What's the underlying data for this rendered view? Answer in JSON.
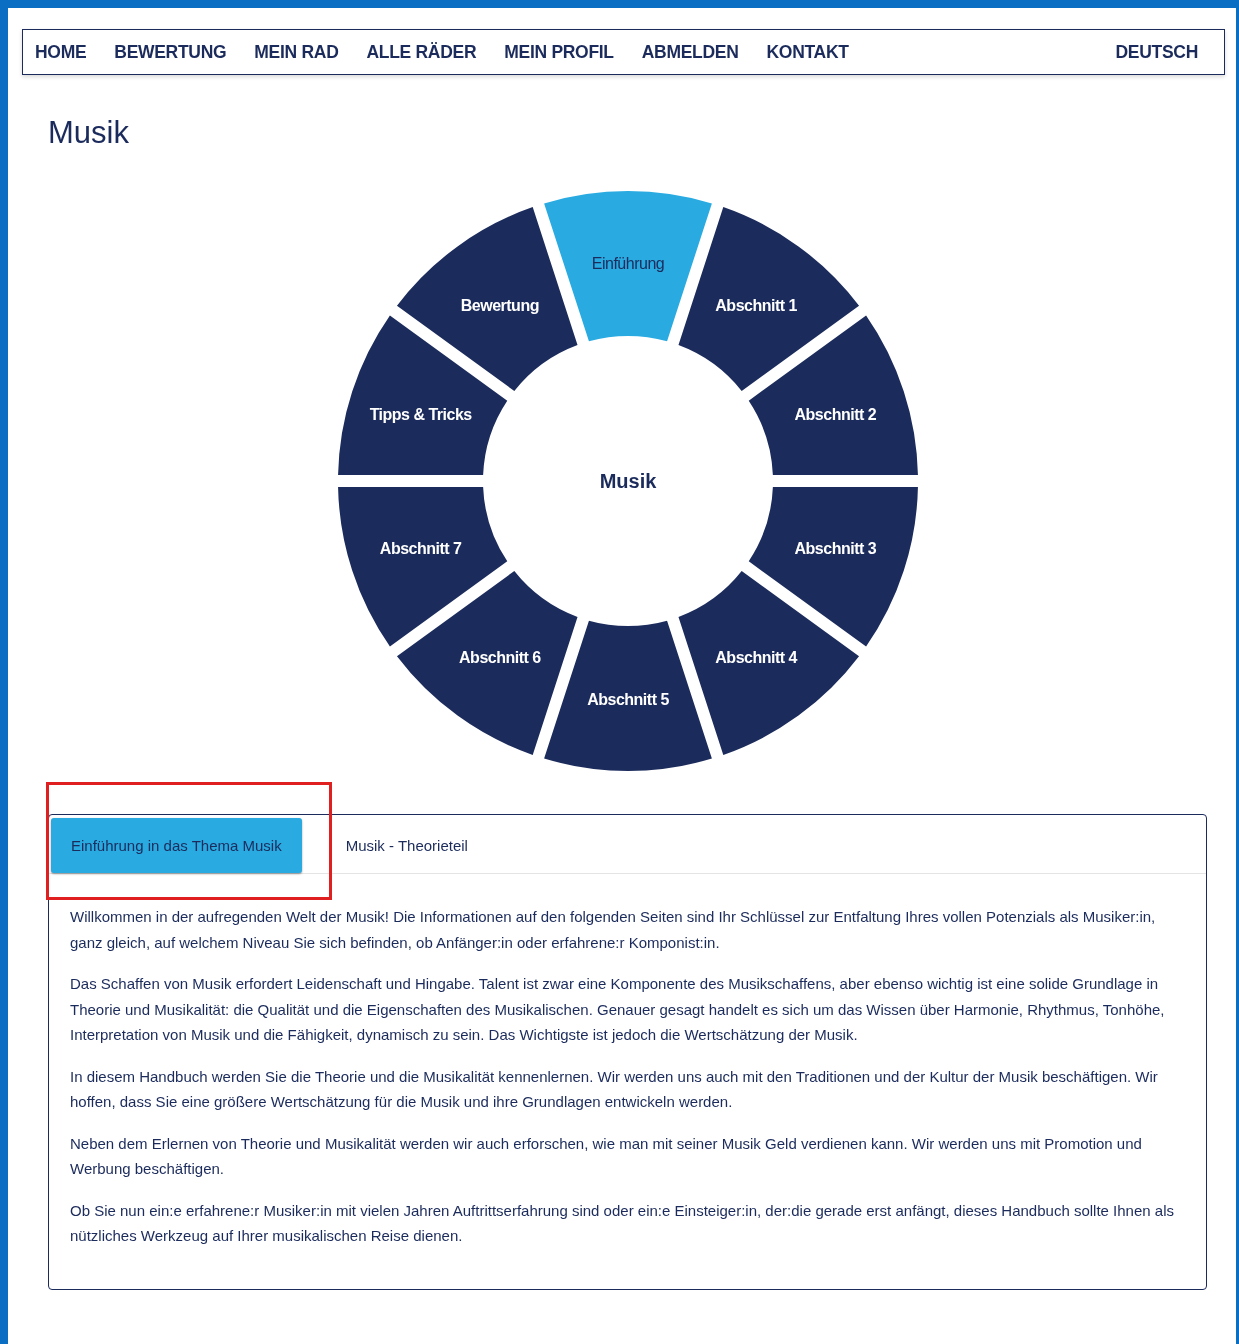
{
  "nav": {
    "items": [
      "HOME",
      "BEWERTUNG",
      "MEIN RAD",
      "ALLE RÄDER",
      "MEIN PROFIL",
      "ABMELDEN",
      "KONTAKT"
    ],
    "language": "DEUTSCH"
  },
  "title": "Musik",
  "wheel": {
    "center": "Musik",
    "segments": [
      {
        "label": "Einführung",
        "selected": true
      },
      {
        "label": "Abschnitt 1",
        "selected": false
      },
      {
        "label": "Abschnitt 2",
        "selected": false
      },
      {
        "label": "Abschnitt 3",
        "selected": false
      },
      {
        "label": "Abschnitt 4",
        "selected": false
      },
      {
        "label": "Abschnitt 5",
        "selected": false
      },
      {
        "label": "Abschnitt 6",
        "selected": false
      },
      {
        "label": "Abschnitt 7",
        "selected": false
      },
      {
        "label": "Tipps & Tricks",
        "selected": false
      },
      {
        "label": "Bewertung",
        "selected": false
      }
    ]
  },
  "tabs": [
    {
      "label": "Einführung in das Thema Musik",
      "selected": true
    },
    {
      "label": "Musik - Theorieteil",
      "selected": false
    }
  ],
  "paragraphs": [
    "Willkommen in der aufregenden Welt der Musik! Die Informationen auf den folgenden Seiten sind Ihr Schlüssel zur Entfaltung Ihres vollen Potenzials als Musiker:in, ganz gleich, auf welchem Niveau Sie sich befinden, ob Anfänger:in oder erfahrene:r Komponist:in.",
    "Das Schaffen von Musik erfordert Leidenschaft und Hingabe. Talent ist zwar eine Komponente des Musikschaffens, aber ebenso wichtig ist eine solide Grundlage in Theorie und Musikalität: die Qualität und die Eigenschaften des Musikalischen. Genauer gesagt handelt es sich um das Wissen über Harmonie, Rhythmus, Tonhöhe, Interpretation von Musik und die Fähigkeit, dynamisch zu sein. Das Wichtigste ist jedoch die Wertschätzung der Musik.",
    "In diesem Handbuch werden Sie die Theorie und die Musikalität kennenlernen. Wir werden uns auch mit den Traditionen und der Kultur der Musik beschäftigen. Wir hoffen, dass Sie eine größere Wertschätzung für die Musik und ihre Grundlagen entwickeln werden.",
    "Neben dem Erlernen von Theorie und Musikalität werden wir auch erforschen, wie man mit seiner Musik Geld verdienen kann. Wir werden uns mit Promotion und Werbung beschäftigen.",
    "Ob Sie nun ein:e erfahrene:r Musiker:in mit vielen Jahren Auftrittserfahrung sind oder ein:e Einsteiger:in, der:die gerade erst anfängt, dieses Handbuch sollte Ihnen als nützliches Werkzeug auf Ihrer musikalischen Reise dienen."
  ]
}
